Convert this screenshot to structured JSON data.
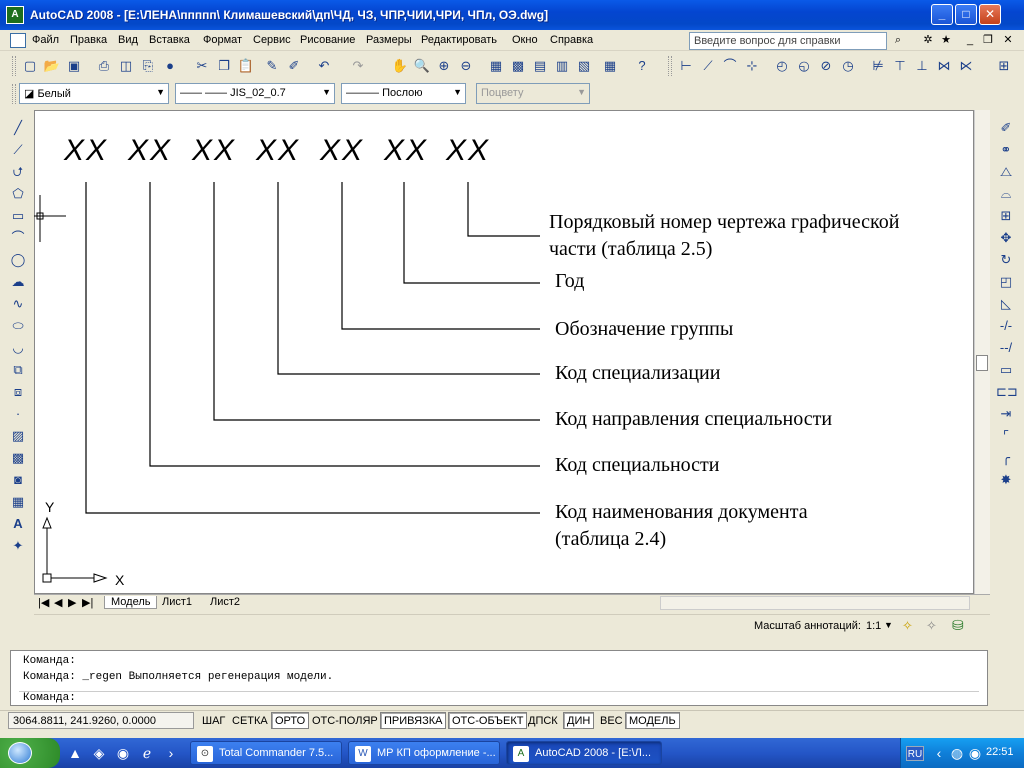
{
  "window": {
    "title": "AutoCAD 2008 - [E:\\ЛЕНА\\ппппп\\ Климашевский\\дп\\ЧД, ЧЗ, ЧПР,ЧИИ,ЧРИ, ЧПл, ОЭ.dwg]",
    "app_icon_text": "A",
    "min": "_",
    "max": "□",
    "close": "✕"
  },
  "menu": {
    "items": [
      "Файл",
      "Правка",
      "Вид",
      "Вставка",
      "Формат",
      "Сервис",
      "Рисование",
      "Размеры",
      "Редактировать",
      "Окно",
      "Справка"
    ],
    "help_placeholder": "Введите вопрос для справки"
  },
  "layers": {
    "color": "Белый",
    "linetype": "JIS_02_0.7",
    "lineweight": "Послою",
    "plotstyle": "Поцвету"
  },
  "drawing": {
    "codes": [
      "XX",
      "XX",
      "XX",
      "XX",
      "XX",
      "XX",
      "XX"
    ],
    "captions": [
      "Порядковый номер чертежа графической",
      "части  (таблица 2.5)",
      "Год",
      "Обозначение группы",
      "Код специализации",
      "Код направления специальности",
      "Код специальности",
      "Код наименования документа",
      "(таблица 2.4)"
    ],
    "axis_x": "X",
    "axis_y": "Y"
  },
  "tabs": [
    "Модель",
    "Лист1",
    "Лист2"
  ],
  "annotation": {
    "label": "Масштаб аннотаций:",
    "value": "1:1"
  },
  "command": {
    "lines": [
      "Команда:",
      "Команда: _regen Выполняется регенерация модели.",
      "Команда:"
    ]
  },
  "status": {
    "coords": "3064.8811, 241.9260, 0.0000",
    "buttons": [
      "ШАГ",
      "СЕТКА",
      "ОРТО",
      "ОТС-ПОЛЯР",
      "ПРИВЯЗКА",
      "ОТС-ОБЪЕКТ",
      "ДПСК",
      "ДИН",
      "ВЕС",
      "МОДЕЛЬ"
    ]
  },
  "taskbar": {
    "tasks": [
      "Total Commander 7.5...",
      "МР КП  оформление -...",
      "AutoCAD 2008 - [E:\\Л..."
    ],
    "lang": "RU",
    "clock": "22:51"
  },
  "colors": {
    "title_blue": "#0445d0",
    "canvas_bg": "#ffffff",
    "taskbar_blue": "#2456c7"
  }
}
